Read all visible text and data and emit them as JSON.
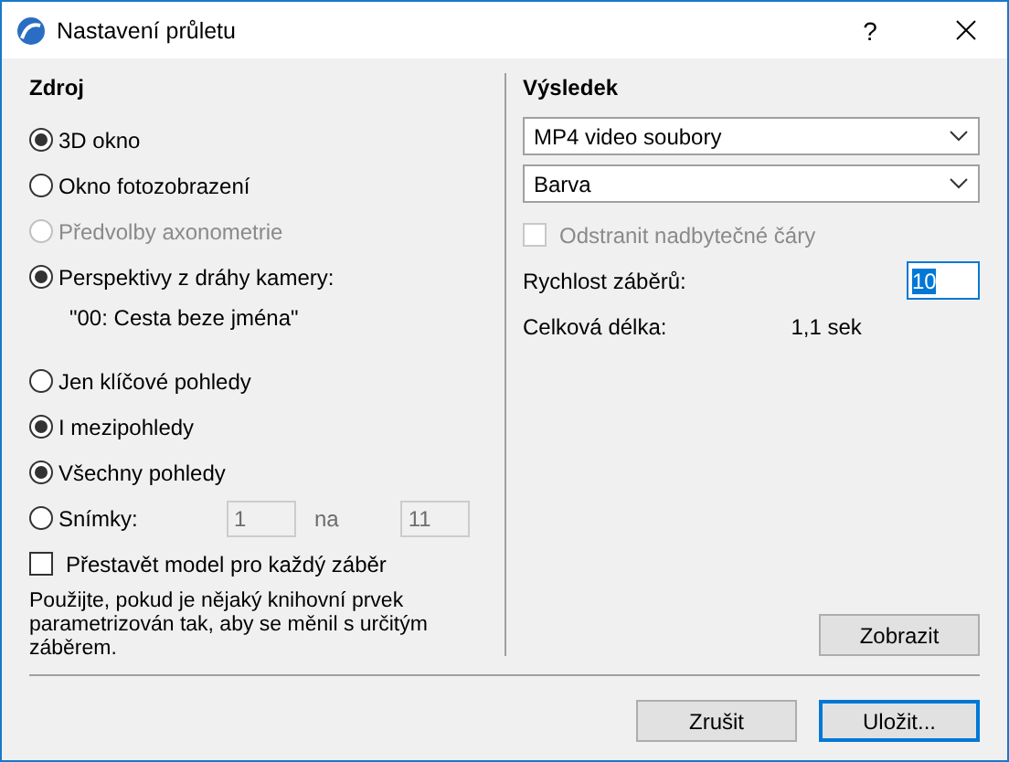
{
  "window": {
    "title": "Nastavení průletu",
    "help": "?"
  },
  "source": {
    "heading": "Zdroj",
    "options": [
      {
        "label": "3D okno",
        "selected": true,
        "disabled": false
      },
      {
        "label": "Okno fotozobrazení",
        "selected": false,
        "disabled": false
      },
      {
        "label": "Předvolby axonometrie",
        "selected": false,
        "disabled": true
      },
      {
        "label": "Perspektivy z dráhy kamery:",
        "selected": true,
        "disabled": false
      }
    ],
    "camera_path": "\"00: Cesta beze jména\""
  },
  "frames": {
    "options": [
      {
        "kind": "radio",
        "label": "Jen klíčové pohledy",
        "selected": false
      },
      {
        "kind": "radio",
        "label": "I mezipohledy",
        "selected": true
      },
      {
        "kind": "radio",
        "label": "Všechny pohledy",
        "selected": true
      },
      {
        "kind": "range",
        "label": "Snímky:",
        "selected": false,
        "from": "1",
        "separator": "na",
        "to": "11"
      }
    ]
  },
  "rebuild": {
    "label": "Přestavět model pro každý záběr",
    "checked": false
  },
  "note": "Použijte, pokud je nějaký knihovní prvek parametrizován tak, aby se měnil s určitým záběrem.",
  "result": {
    "heading": "Výsledek",
    "format": "MP4 video soubory",
    "color_mode": "Barva",
    "remove_lines": {
      "label": "Odstranit nadbytečné čáry",
      "checked": false,
      "disabled": true
    },
    "frame_rate": {
      "label": "Rychlost záběrů:",
      "value": "10",
      "focused": true
    },
    "total_length": {
      "label": "Celková délka:",
      "value": "1,1 sek"
    }
  },
  "preview_button": "Zobrazit",
  "buttons": [
    {
      "label": "Zrušit",
      "default": false
    },
    {
      "label": "Uložit...",
      "default": true
    }
  ]
}
